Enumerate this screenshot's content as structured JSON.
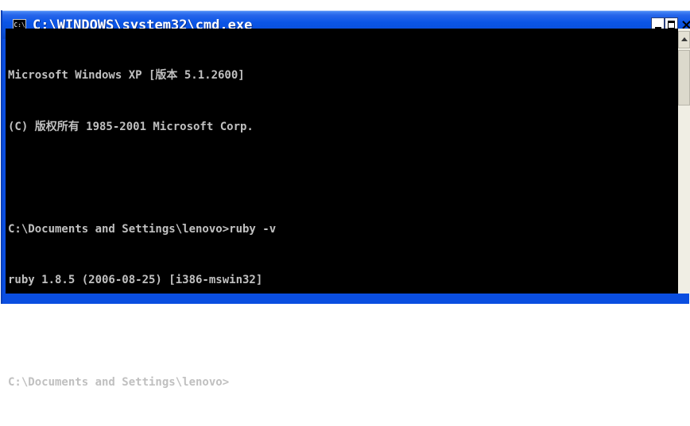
{
  "window": {
    "title": "C:\\WINDOWS\\system32\\cmd.exe",
    "icon": "cmd-icon",
    "icon_glyph": "C:\\",
    "close_glyph": "×"
  },
  "console": {
    "lines": [
      "Microsoft Windows XP [版本 5.1.2600]",
      "(C) 版权所有 1985-2001 Microsoft Corp.",
      "",
      "C:\\Documents and Settings\\lenovo>ruby -v",
      "ruby 1.8.5 (2006-08-25) [i386-mswin32]",
      "",
      "C:\\Documents and Settings\\lenovo>"
    ]
  },
  "colors": {
    "titlebar": "#0a55e6",
    "console_bg": "#000000",
    "console_fg": "#c0c0c0"
  }
}
